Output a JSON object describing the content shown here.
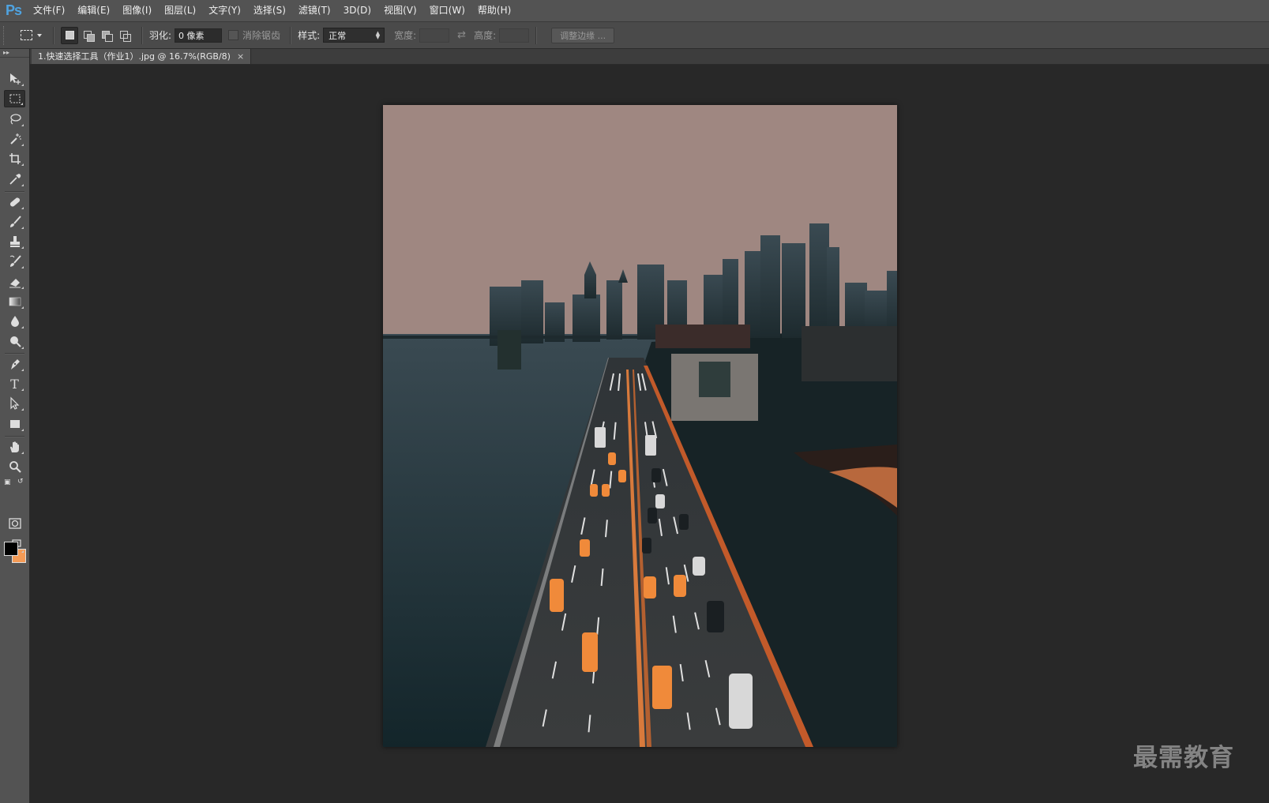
{
  "app": {
    "logo": "Ps",
    "menu": [
      "文件(F)",
      "编辑(E)",
      "图像(I)",
      "图层(L)",
      "文字(Y)",
      "选择(S)",
      "滤镜(T)",
      "3D(D)",
      "视图(V)",
      "窗口(W)",
      "帮助(H)"
    ]
  },
  "options": {
    "feather_label": "羽化:",
    "feather_value": "0 像素",
    "antialias_label": "消除锯齿",
    "style_label": "样式:",
    "style_value": "正常",
    "width_label": "宽度:",
    "height_label": "高度:",
    "refine_edge_label": "调整边缘 ..."
  },
  "tools": [
    "move-tool",
    "rectangular-marquee-tool",
    "lasso-tool",
    "magic-wand-tool",
    "crop-tool",
    "eyedropper-tool",
    "spot-healing-brush-tool",
    "brush-tool",
    "clone-stamp-tool",
    "history-brush-tool",
    "eraser-tool",
    "gradient-tool",
    "blur-tool",
    "dodge-tool",
    "pen-tool",
    "type-tool",
    "path-selection-tool",
    "rectangle-tool",
    "hand-tool",
    "zoom-tool"
  ],
  "active_tool": "rectangular-marquee-tool",
  "type_tool_glyph": "T",
  "colors": {
    "foreground": "#000000",
    "background": "#f49a55"
  },
  "document": {
    "tab_title": "1.快速选择工具（作业1）.jpg @ 16.7%(RGB/8)",
    "close_glyph": "×"
  },
  "watermark": "最需教育"
}
